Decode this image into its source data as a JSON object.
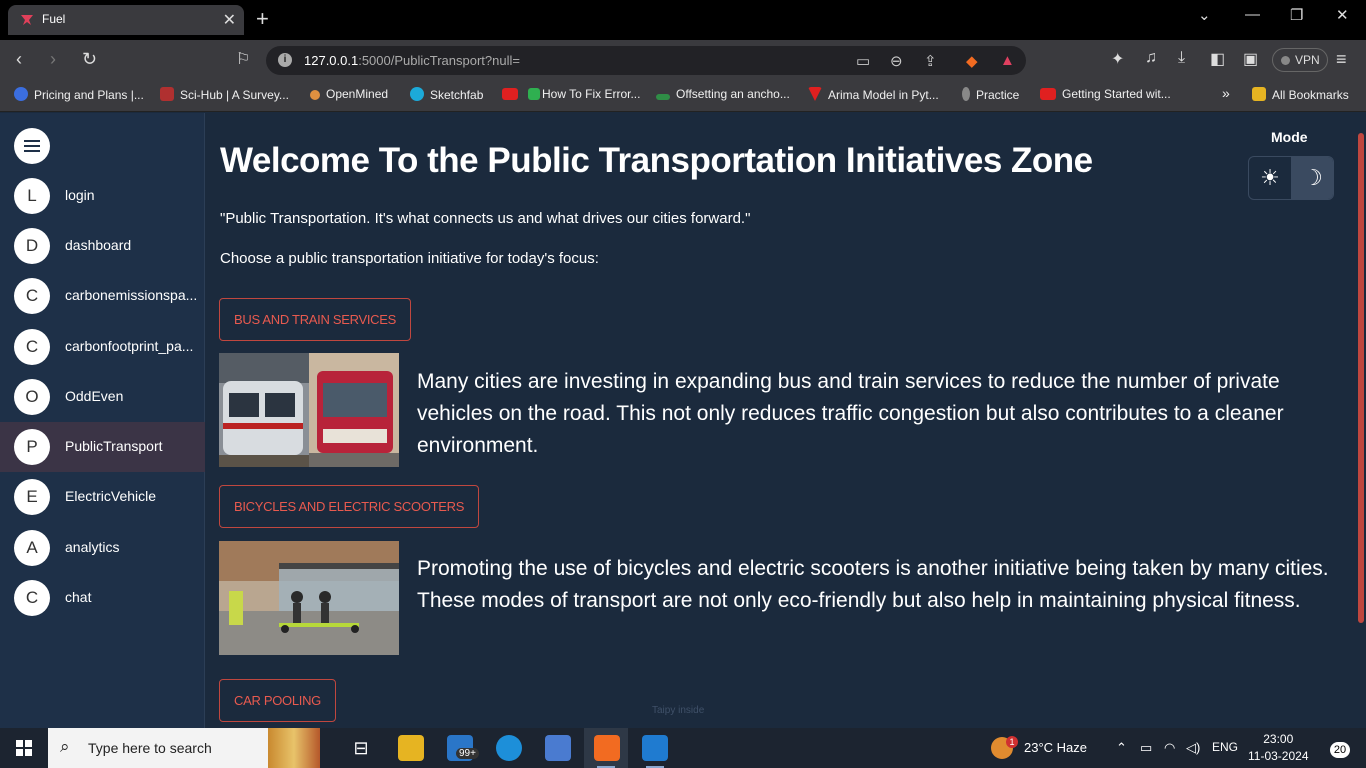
{
  "browser": {
    "tab_title": "Fuel",
    "new_tab": "+",
    "url_host": "127.0.0.1",
    "url_rest": ":5000/PublicTransport?null=",
    "vpn_label": "VPN",
    "bookmarks": [
      {
        "label": "Pricing and Plans |...",
        "color": "#3b6ee0"
      },
      {
        "label": "Sci-Hub | A Survey...",
        "color": "#b03030"
      },
      {
        "label": "OpenMined",
        "color": "#e09040"
      },
      {
        "label": "Sketchfab",
        "color": "#1caad9"
      },
      {
        "label": "",
        "color": "#e02020"
      },
      {
        "label": "How To Fix Error...",
        "color": "#2fb050"
      },
      {
        "label": "Offsetting an ancho...",
        "color": "#2f8d46"
      },
      {
        "label": "Arima Model in Pyt...",
        "color": "#e02020"
      },
      {
        "label": "Practice",
        "color": "#888"
      },
      {
        "label": "Getting Started wit...",
        "color": "#e02020"
      }
    ],
    "more_bookmarks": "»",
    "all_bookmarks": "All Bookmarks"
  },
  "sidebar": {
    "items": [
      {
        "initial": "L",
        "label": "login"
      },
      {
        "initial": "D",
        "label": "dashboard"
      },
      {
        "initial": "C",
        "label": "carbonemissionspa..."
      },
      {
        "initial": "C",
        "label": "carbonfootprint_pa..."
      },
      {
        "initial": "O",
        "label": "OddEven"
      },
      {
        "initial": "P",
        "label": "PublicTransport"
      },
      {
        "initial": "E",
        "label": "ElectricVehicle"
      },
      {
        "initial": "A",
        "label": "analytics"
      },
      {
        "initial": "C",
        "label": "chat"
      }
    ],
    "active_index": 5
  },
  "main": {
    "title": "Welcome To the Public Transportation Initiatives Zone",
    "quote": "\"Public Transportation. It's what connects us and what drives our cities forward.\"",
    "prompt": "Choose a public transportation initiative for today's focus:",
    "initiatives": [
      {
        "button": "BUS AND TRAIN SERVICES",
        "description": "Many cities are investing in expanding bus and train services to reduce the number of private vehicles on the road. This not only reduces traffic congestion but also contributes to a cleaner environment."
      },
      {
        "button": "BICYCLES AND ELECTRIC SCOOTERS",
        "description": "Promoting the use of bicycles and electric scooters is another initiative being taken by many cities. These modes of transport are not only eco-friendly but also help in maintaining physical fitness."
      },
      {
        "button": "CAR POOLING",
        "description": ""
      }
    ],
    "mode_label": "Mode",
    "mode_light_icon": "☀",
    "mode_dark_icon": "☽",
    "footer": "Taipy inside"
  },
  "taskbar": {
    "search_placeholder": "Type here to search",
    "mail_badge": "99+",
    "weather": "23°C  Haze",
    "weather_badge": "1",
    "language": "ENG",
    "time": "23:00",
    "date": "11-03-2024",
    "notification_count": "20"
  }
}
